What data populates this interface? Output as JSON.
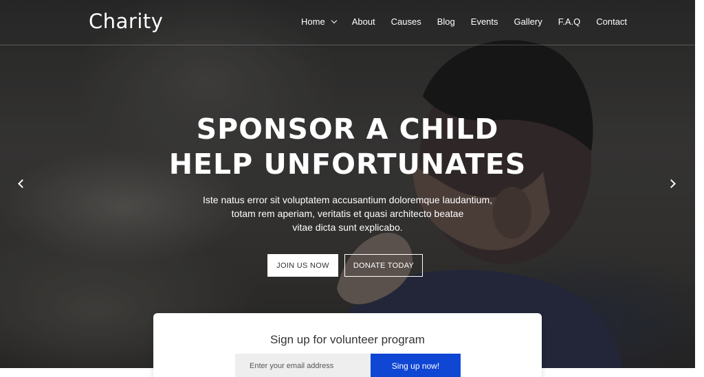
{
  "brand": {
    "logo_text": "Charity"
  },
  "nav": {
    "items": [
      {
        "label": "Home",
        "has_dropdown": true
      },
      {
        "label": "About"
      },
      {
        "label": "Causes"
      },
      {
        "label": "Blog"
      },
      {
        "label": "Events"
      },
      {
        "label": "Gallery"
      },
      {
        "label": "F.A.Q"
      },
      {
        "label": "Contact"
      }
    ]
  },
  "hero": {
    "headline_line1": "SPONSOR A CHILD",
    "headline_line2": "HELP UNFORTUNATES",
    "subtext_line1": "Iste natus error sit voluptatem accusantium doloremque laudantium,",
    "subtext_line2": "totam rem aperiam, veritatis et quasi architecto beatae",
    "subtext_line3": "vitae dicta sunt explicabo.",
    "primary_button": "JOIN US NOW",
    "secondary_button": "DONATE TODAY"
  },
  "slider": {
    "prev_icon": "chevron-left-icon",
    "next_icon": "chevron-right-icon"
  },
  "volunteer": {
    "title": "Sign up for volunteer program",
    "email_placeholder": "Enter your email address",
    "submit_label": "Sing up now!"
  },
  "colors": {
    "accent": "#1046d4",
    "text_light": "#ffffff",
    "card_bg": "#ffffff"
  }
}
